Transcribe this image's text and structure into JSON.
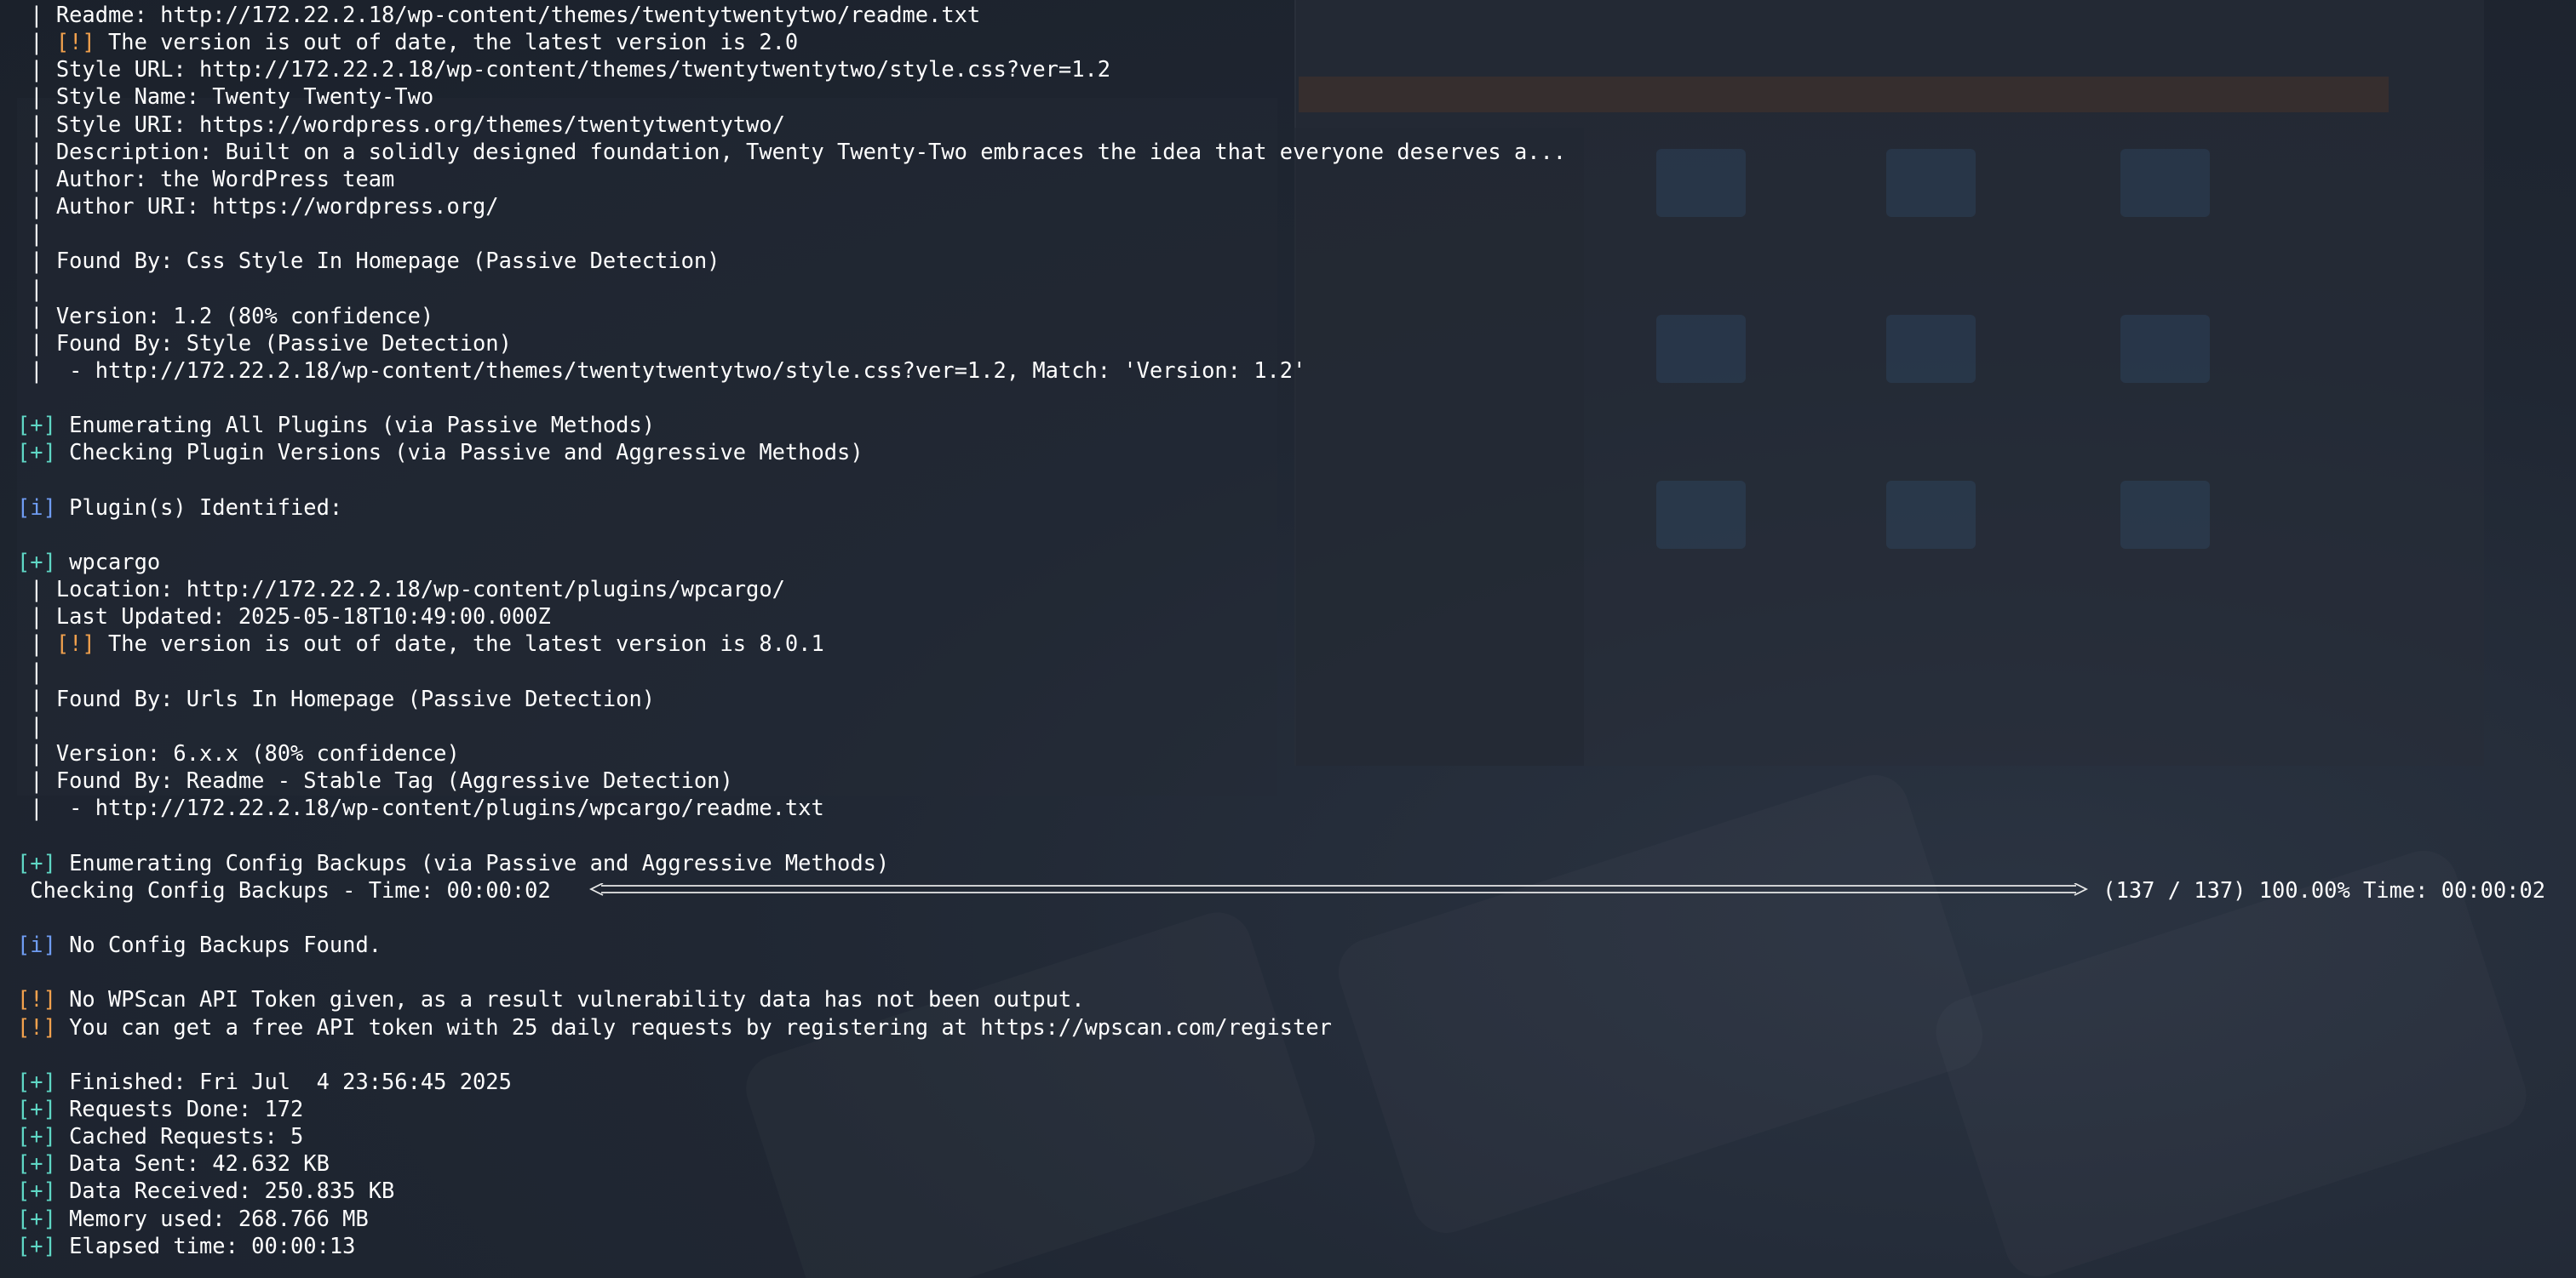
{
  "lines": [
    {
      "prefix": " | ",
      "tag": "",
      "text": "Readme: http://172.22.2.18/wp-content/themes/twentytwentytwo/readme.txt"
    },
    {
      "prefix": " | ",
      "tag": "[!]",
      "tagtype": "warn",
      "text": " The version is out of date, the latest version is 2.0"
    },
    {
      "prefix": " | ",
      "tag": "",
      "text": "Style URL: http://172.22.2.18/wp-content/themes/twentytwentytwo/style.css?ver=1.2"
    },
    {
      "prefix": " | ",
      "tag": "",
      "text": "Style Name: Twenty Twenty-Two"
    },
    {
      "prefix": " | ",
      "tag": "",
      "text": "Style URI: https://wordpress.org/themes/twentytwentytwo/"
    },
    {
      "prefix": " | ",
      "tag": "",
      "text": "Description: Built on a solidly designed foundation, Twenty Twenty-Two embraces the idea that everyone deserves a..."
    },
    {
      "prefix": " | ",
      "tag": "",
      "text": "Author: the WordPress team"
    },
    {
      "prefix": " | ",
      "tag": "",
      "text": "Author URI: https://wordpress.org/"
    },
    {
      "prefix": " |",
      "tag": "",
      "text": ""
    },
    {
      "prefix": " | ",
      "tag": "",
      "text": "Found By: Css Style In Homepage (Passive Detection)"
    },
    {
      "prefix": " |",
      "tag": "",
      "text": ""
    },
    {
      "prefix": " | ",
      "tag": "",
      "text": "Version: 1.2 (80% confidence)"
    },
    {
      "prefix": " | ",
      "tag": "",
      "text": "Found By: Style (Passive Detection)"
    },
    {
      "prefix": " | ",
      "tag": "",
      "text": " - http://172.22.2.18/wp-content/themes/twentytwentytwo/style.css?ver=1.2, Match: 'Version: 1.2'"
    },
    {
      "prefix": "",
      "tag": "",
      "text": ""
    },
    {
      "prefix": "",
      "tag": "[+]",
      "tagtype": "plus",
      "text": " Enumerating All Plugins (via Passive Methods)"
    },
    {
      "prefix": "",
      "tag": "[+]",
      "tagtype": "plus",
      "text": " Checking Plugin Versions (via Passive and Aggressive Methods)"
    },
    {
      "prefix": "",
      "tag": "",
      "text": ""
    },
    {
      "prefix": "",
      "tag": "[i]",
      "tagtype": "info",
      "text": " Plugin(s) Identified:"
    },
    {
      "prefix": "",
      "tag": "",
      "text": ""
    },
    {
      "prefix": "",
      "tag": "[+]",
      "tagtype": "plus",
      "text": " wpcargo"
    },
    {
      "prefix": " | ",
      "tag": "",
      "text": "Location: http://172.22.2.18/wp-content/plugins/wpcargo/"
    },
    {
      "prefix": " | ",
      "tag": "",
      "text": "Last Updated: 2025-05-18T10:49:00.000Z"
    },
    {
      "prefix": " | ",
      "tag": "[!]",
      "tagtype": "warn",
      "text": " The version is out of date, the latest version is 8.0.1"
    },
    {
      "prefix": " |",
      "tag": "",
      "text": ""
    },
    {
      "prefix": " | ",
      "tag": "",
      "text": "Found By: Urls In Homepage (Passive Detection)"
    },
    {
      "prefix": " |",
      "tag": "",
      "text": ""
    },
    {
      "prefix": " | ",
      "tag": "",
      "text": "Version: 6.x.x (80% confidence)"
    },
    {
      "prefix": " | ",
      "tag": "",
      "text": "Found By: Readme - Stable Tag (Aggressive Detection)"
    },
    {
      "prefix": " | ",
      "tag": "",
      "text": " - http://172.22.2.18/wp-content/plugins/wpcargo/readme.txt"
    },
    {
      "prefix": "",
      "tag": "",
      "text": ""
    },
    {
      "prefix": "",
      "tag": "[+]",
      "tagtype": "plus",
      "text": " Enumerating Config Backups (via Passive and Aggressive Methods)"
    }
  ],
  "progress": {
    "label": " Checking Config Backups - Time: 00:00:02 ",
    "status": " (137 / 137) 100.00% Time: 00:00:02",
    "fraction": 1.0
  },
  "lines_after": [
    {
      "prefix": "",
      "tag": "",
      "text": ""
    },
    {
      "prefix": "",
      "tag": "[i]",
      "tagtype": "info",
      "text": " No Config Backups Found."
    },
    {
      "prefix": "",
      "tag": "",
      "text": ""
    },
    {
      "prefix": "",
      "tag": "[!]",
      "tagtype": "warn",
      "text": " No WPScan API Token given, as a result vulnerability data has not been output."
    },
    {
      "prefix": "",
      "tag": "[!]",
      "tagtype": "warn",
      "text": " You can get a free API token with 25 daily requests by registering at https://wpscan.com/register"
    },
    {
      "prefix": "",
      "tag": "",
      "text": ""
    },
    {
      "prefix": "",
      "tag": "[+]",
      "tagtype": "plus",
      "text": " Finished: Fri Jul  4 23:56:45 2025"
    },
    {
      "prefix": "",
      "tag": "[+]",
      "tagtype": "plus",
      "text": " Requests Done: 172"
    },
    {
      "prefix": "",
      "tag": "[+]",
      "tagtype": "plus",
      "text": " Cached Requests: 5"
    },
    {
      "prefix": "",
      "tag": "[+]",
      "tagtype": "plus",
      "text": " Data Sent: 42.632 KB"
    },
    {
      "prefix": "",
      "tag": "[+]",
      "tagtype": "plus",
      "text": " Data Received: 250.835 KB"
    },
    {
      "prefix": "",
      "tag": "[+]",
      "tagtype": "plus",
      "text": " Memory used: 268.766 MB"
    },
    {
      "prefix": "",
      "tag": "[+]",
      "tagtype": "plus",
      "text": " Elapsed time: 00:00:13"
    }
  ]
}
